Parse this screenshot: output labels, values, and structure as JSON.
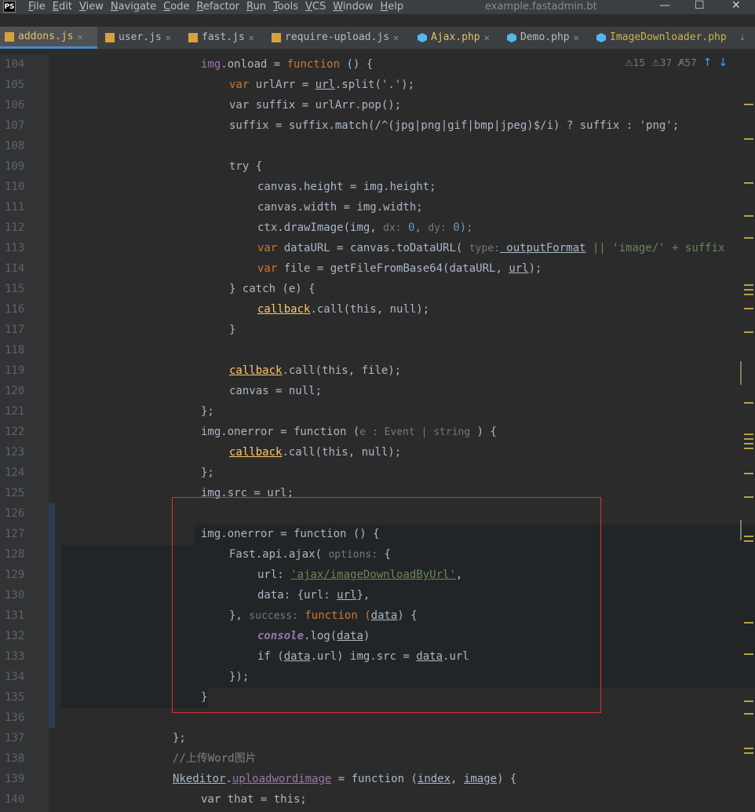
{
  "app": {
    "icon_label": "PS",
    "window_title": "example.fastadmin.bt"
  },
  "menu": [
    "File",
    "Edit",
    "View",
    "Navigate",
    "Code",
    "Refactor",
    "Run",
    "Tools",
    "VCS",
    "Window",
    "Help"
  ],
  "window_controls": {
    "minimize": "—",
    "maximize": "☐",
    "close": "✕"
  },
  "tabs": [
    {
      "label": "addons.js",
      "type": "js",
      "active": true
    },
    {
      "label": "user.js",
      "type": "js",
      "active": false
    },
    {
      "label": "fast.js",
      "type": "js",
      "active": false
    },
    {
      "label": "require-upload.js",
      "type": "js",
      "active": false
    },
    {
      "label": "Ajax.php",
      "type": "php",
      "active": false
    },
    {
      "label": "Demo.php",
      "type": "php",
      "active": false
    },
    {
      "label": "ImageDownloader.php",
      "type": "php",
      "active": false
    }
  ],
  "tab_close": "✕",
  "tabs_overflow": "⇣",
  "inspections": {
    "warnings": "15",
    "weak_warnings": "37",
    "typos": "57",
    "warn_icon": "⚠",
    "typo_icon": "A̸",
    "up": "↑",
    "down": "↓"
  },
  "line_numbers": [
    "104",
    "105",
    "106",
    "107",
    "108",
    "109",
    "110",
    "111",
    "112",
    "113",
    "114",
    "115",
    "116",
    "117",
    "118",
    "119",
    "120",
    "121",
    "122",
    "123",
    "124",
    "125",
    "126",
    "127",
    "128",
    "129",
    "130",
    "131",
    "132",
    "133",
    "134",
    "135",
    "136",
    "137",
    "138",
    "139",
    "140"
  ],
  "colors": {
    "background": "#2b2b2b",
    "keyword": "#cc7832",
    "function": "#ffc66d",
    "string": "#6a8759",
    "number": "#6897bb",
    "property": "#9876aa",
    "highlight_box": "#e03030"
  },
  "code": {
    "l104": "img.onload = function () {",
    "l105a": "var",
    "l105b": " urlArr = ",
    "l105c": "url",
    "l105d": ".split('.');",
    "l106": "var suffix = urlArr.pop();",
    "l107": "suffix = suffix.match(/^(jpg|png|gif|bmp|jpeg)$/i) ? suffix : 'png';",
    "l109": "try {",
    "l110": "canvas.height = img.height;",
    "l111": "canvas.width = img.width;",
    "l112a": "ctx.drawImage(img, ",
    "l112h1": "dx:",
    "l112b": " 0, ",
    "l112h2": "dy:",
    "l112c": " 0);",
    "l113a": "var",
    "l113b": " dataURL = canvas.toDataURL( ",
    "l113h": "type:",
    "l113c": " outputFormat",
    "l113d": " || 'image/' + suffix",
    "l114a": "var",
    "l114b": " file = getFileFromBase64(dataURL, ",
    "l114c": "url",
    "l114d": ");",
    "l115": "} catch (e) {",
    "l116a": "callback",
    "l116b": ".call(this, null);",
    "l117": "}",
    "l119a": "callback",
    "l119b": ".call(this, file);",
    "l120": "canvas = null;",
    "l121": "};",
    "l122a": "img.onerror = function (",
    "l122h": "e : Event | string",
    "l122b": " ) {",
    "l123a": "callback",
    "l123b": ".call(this, null);",
    "l124": "};",
    "l125a": "img.src = ",
    "l125b": "url",
    "l125c": ";",
    "l127": "img.onerror = function () {",
    "l128a": "Fast.api.ajax( ",
    "l128h": "options:",
    "l128b": " {",
    "l129a": "url: ",
    "l129b": "'ajax/imageDownloadByUrl'",
    "l129c": ",",
    "l130a": "data: {url: ",
    "l130b": "url",
    "l130c": "},",
    "l131a": "}, ",
    "l131h": "success:",
    "l131b": " function (",
    "l131c": "data",
    "l131d": ") {",
    "l132a": "console",
    "l132b": ".log(",
    "l132c": "data",
    "l132d": ")",
    "l133a": "if (",
    "l133b": "data",
    "l133c": ".url) img.src = ",
    "l133d": "data",
    "l133e": ".url",
    "l134": "});",
    "l135": "}",
    "l137": "};",
    "l138": "//上传Word图片",
    "l139a": "Nkeditor",
    "l139b": ".",
    "l139c": "uploadwordimage",
    "l139d": " = function (",
    "l139e": "index",
    "l139f": ", ",
    "l139g": "image",
    "l139h": ") {",
    "l140": "var that = this;"
  }
}
